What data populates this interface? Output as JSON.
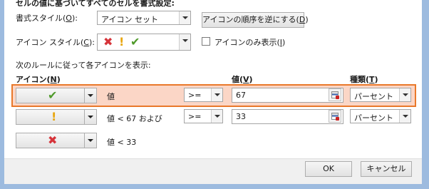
{
  "header": {
    "title": "セルの値に基づいてすべてのセルを書式設定:"
  },
  "format_style": {
    "label_pre": "書式スタイル(",
    "label_key": "O",
    "label_post": "):",
    "value": "アイコン セット"
  },
  "reverse_button": {
    "label_pre": "アイコンの順序を逆にする(",
    "label_key": "D",
    "label_post": ")"
  },
  "icon_style": {
    "label_pre": "アイコン スタイル(",
    "label_key": "C",
    "label_post": "):",
    "icons": [
      "x-mark-icon",
      "exclamation-icon",
      "checkmark-icon"
    ]
  },
  "icon_only": {
    "label_pre": "アイコンのみ表示(",
    "label_key": "I",
    "label_post": ")",
    "checked": false
  },
  "rules_heading": "次のルールに従って各アイコンを表示:",
  "columns": {
    "icon": {
      "pre": "アイコン(",
      "key": "N",
      "post": ")"
    },
    "value": {
      "pre": "値(",
      "key": "V",
      "post": ")"
    },
    "type": {
      "pre": "種類(",
      "key": "T",
      "post": ")"
    }
  },
  "rules": [
    {
      "icon": "checkmark-icon",
      "glyph": "✔",
      "condition_text": "値",
      "operator": ">=",
      "value": "67",
      "type": "パーセント",
      "highlighted": true
    },
    {
      "icon": "exclamation-icon",
      "glyph": "!",
      "condition_text": "値 < 67 および",
      "operator": ">=",
      "value": "33",
      "type": "パーセント",
      "highlighted": false
    },
    {
      "icon": "x-mark-icon",
      "glyph": "✖",
      "condition_text": "値 < 33"
    }
  ],
  "buttons": {
    "ok": "OK",
    "cancel": "キャンセル"
  },
  "colors": {
    "highlight_border": "#e9782a",
    "highlight_fill": "#fbd6c6",
    "check": "#4f9a2a",
    "exclamation": "#e8a60f",
    "x_mark": "#d6343a"
  }
}
